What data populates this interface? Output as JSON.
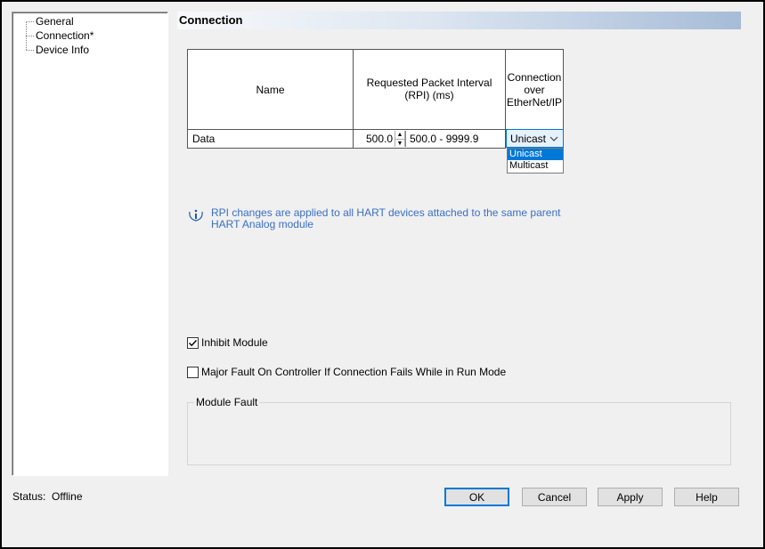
{
  "tree": {
    "items": [
      {
        "label": "General"
      },
      {
        "label": "Connection*"
      },
      {
        "label": "Device Info"
      }
    ]
  },
  "header": {
    "title": "Connection"
  },
  "table": {
    "columns": {
      "name": "Name",
      "rpi": "Requested Packet Interval (RPI) (ms)",
      "connection": "Connection over EtherNet/IP"
    },
    "rows": [
      {
        "name": "Data",
        "rpi_value": "500.0",
        "rpi_range": "500.0 - 9999.9",
        "connection": "Unicast"
      }
    ],
    "connection_options": [
      "Unicast",
      "Multicast"
    ],
    "selected_option": "Unicast"
  },
  "info": {
    "icon": "info-icon",
    "text": "RPI changes are applied to all HART devices attached to the same parent HART Analog module"
  },
  "options": {
    "inhibit_module": {
      "label": "Inhibit Module",
      "checked": true
    },
    "major_fault": {
      "label": "Major Fault On Controller If Connection Fails While in Run Mode",
      "checked": false
    }
  },
  "module_fault": {
    "title": "Module Fault"
  },
  "status": {
    "label": "Status:",
    "value": "Offline"
  },
  "buttons": {
    "ok": "OK",
    "cancel": "Cancel",
    "apply": "Apply",
    "help": "Help"
  },
  "colors": {
    "accent": "#0078d7",
    "info_text": "#3a6fc4",
    "header_gradient_end": "#a6bcd7"
  }
}
